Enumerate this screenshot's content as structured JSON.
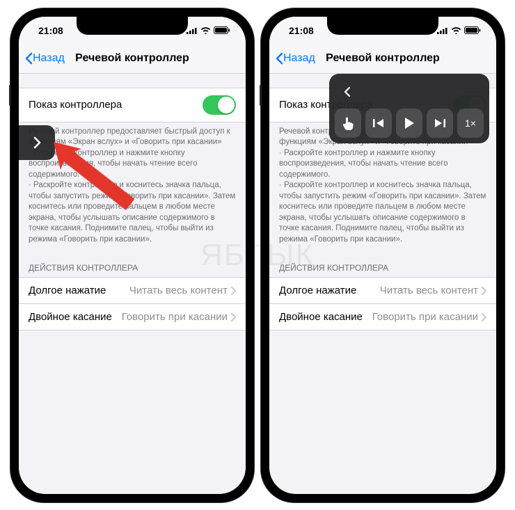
{
  "status": {
    "time": "21:08"
  },
  "nav": {
    "back": "Назад",
    "title": "Речевой контроллер"
  },
  "toggle_row": {
    "label": "Показ контроллера"
  },
  "description": "Речевой контроллер предоставляет быстрый доступ к функциям «Экран вслух» и «Говорить при касании»\n· Раскройте контроллер и нажмите кнопку воспроизведения, чтобы начать чтение всего содержимого.\n· Раскройте контроллер и коснитесь значка пальца, чтобы запустить режим «Говорить при касании». Затем коснитесь или проведите пальцем в любом месте экрана, чтобы услышать описание содержимого в точке касания. Поднимите палец, чтобы выйти из режима «Говорить при касании».",
  "section_header": "ДЕЙСТВИЯ КОНТРОЛЛЕРА",
  "rows": [
    {
      "label": "Долгое нажатие",
      "value": "Читать весь контент"
    },
    {
      "label": "Двойное касание",
      "value": "Говорить при касании"
    }
  ],
  "controller": {
    "speed": "1×"
  },
  "watermark": "ЯБЛЫК"
}
